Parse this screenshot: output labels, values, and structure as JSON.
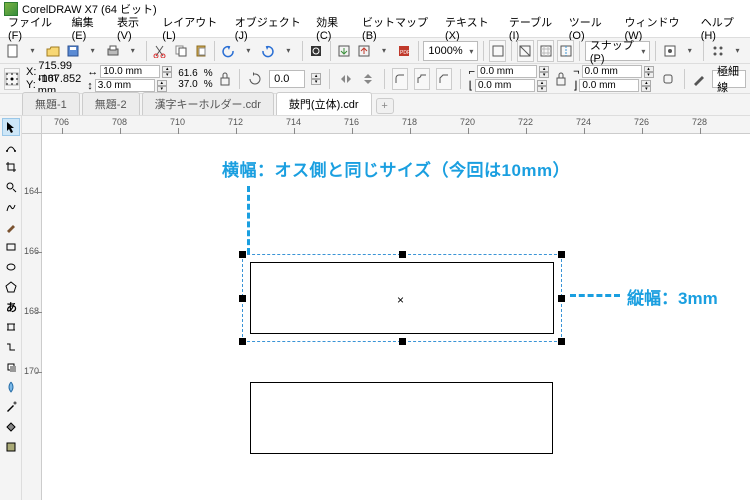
{
  "title": "CorelDRAW X7 (64 ビット)",
  "menu": {
    "file": "ファイル(F)",
    "edit": "編集(E)",
    "view": "表示(V)",
    "layout": "レイアウト(L)",
    "object": "オブジェクト(J)",
    "effects": "効果(C)",
    "bitmaps": "ビットマップ(B)",
    "text": "テキスト(X)",
    "table": "テーブル(I)",
    "tools": "ツール(O)",
    "window": "ウィンドウ(W)",
    "help": "ヘルプ(H)"
  },
  "zoom": "1000%",
  "snap_label": "スナップ(P)",
  "coords": {
    "x_lbl": "X:",
    "x": "715.99 mm",
    "y_lbl": "Y:",
    "y": "-167.852 mm"
  },
  "dims": {
    "w": "10.0 mm",
    "h": "3.0 mm"
  },
  "scale": {
    "w": "61.6",
    "h": "37.0",
    "unit": "%"
  },
  "rotation": "0.0",
  "outline": {
    "w": "0.0 mm",
    "h": "0.0 mm"
  },
  "radius": {
    "w": "0.0 mm",
    "h": "0.0 mm"
  },
  "linewidth": "極細線",
  "tabs": [
    "無題-1",
    "無題-2",
    "漢字キーホルダー.cdr",
    "鼓門(立体).cdr"
  ],
  "active_tab": 3,
  "ruler_h": [
    "706",
    "708",
    "710",
    "712",
    "714",
    "716",
    "718",
    "720",
    "722",
    "724",
    "726",
    "728"
  ],
  "ruler_v": [
    "164",
    "166",
    "168",
    "170"
  ],
  "annotations": {
    "top": "横幅：オス側と同じサイズ（今回は10mm）",
    "right": "縦幅：3mm"
  }
}
